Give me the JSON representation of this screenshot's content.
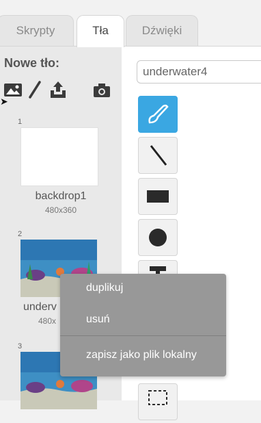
{
  "tabs": [
    {
      "label": "Skrypty",
      "active": false
    },
    {
      "label": "Tła",
      "active": true
    },
    {
      "label": "Dźwięki",
      "active": false
    }
  ],
  "left_panel": {
    "new_backdrop_label": "Nowe tło:",
    "tools": [
      "image-library-icon",
      "paint-brush-icon",
      "upload-icon",
      "camera-icon"
    ],
    "backdrops": [
      {
        "index": "1",
        "name": "backdrop1",
        "size": "480x360"
      },
      {
        "index": "2",
        "name": "underv",
        "size": "480x"
      },
      {
        "index": "3"
      }
    ]
  },
  "editor": {
    "backdrop_name": "underwater4",
    "paint_tools": [
      "brush-icon",
      "line-icon",
      "rectangle-icon",
      "ellipse-icon",
      "text-icon",
      "select-icon"
    ],
    "selected_tool": "brush-icon"
  },
  "context_menu": {
    "items": [
      "duplikuj",
      "usuń",
      "zapisz jako plik lokalny"
    ]
  },
  "colors": {
    "selected_tool": "#3aa7e2",
    "menu_bg": "#989898",
    "panel_bg": "#e9e9e9"
  }
}
